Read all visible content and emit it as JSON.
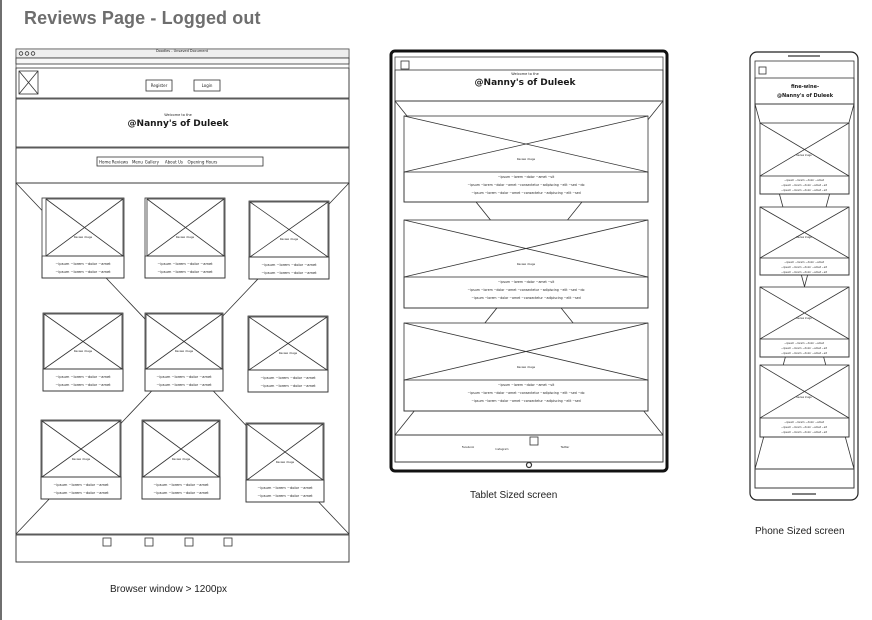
{
  "page": {
    "title": "Reviews Page - Logged out"
  },
  "browser": {
    "caption": "Browser window > 1200px",
    "window_title": "Doodles - Unsaved Document",
    "buttons": {
      "register": "Register",
      "login": "Login"
    },
    "welcome": "Welcome to the",
    "brand": "@Nanny's of Duleek",
    "nav": [
      "Home",
      "Reviews",
      "Menu",
      "Gallery",
      "About Us",
      "Opening Hours"
    ],
    "image_label": "Review image",
    "review_lines": [
      "~ipsum ~lorem ~dolor ~amet",
      "~ipsum ~lorem ~dolor ~amet"
    ],
    "footer_icons": [
      "facebook-icon",
      "instagram-icon",
      "twitter-icon",
      "phone-icon"
    ]
  },
  "tablet": {
    "caption": "Tablet Sized screen",
    "welcome": "Welcome to the",
    "brand": "@Nanny's of Duleek",
    "image_label": "Review image",
    "review_lines": [
      "~ipsum ~lorem ~dolor ~amet ~sit",
      "~ipsum ~lorem ~dolor ~amet ~consectetur ~adipiscing ~elit ~sed ~do",
      "~ipsum ~lorem ~dolor ~amet ~consectetur ~adipiscing ~elit ~sed"
    ],
    "footer_labels": [
      "Facebook",
      "Instagram",
      "Twitter"
    ]
  },
  "phone": {
    "caption": "Phone Sized screen",
    "welcome": "fine-wine-",
    "brand": "@Nanny's of Duleek",
    "image_label": "Review image",
    "review_lines": [
      "~ipsum ~lorem ~dolor ~amet",
      "~ipsum ~lorem ~dolor ~amet ~sit",
      "~ipsum ~lorem ~dolor ~amet ~sit"
    ]
  },
  "colors": {
    "line": "#333333",
    "frame": "#222222",
    "title": "#6e6e6e",
    "device": "#111111"
  }
}
